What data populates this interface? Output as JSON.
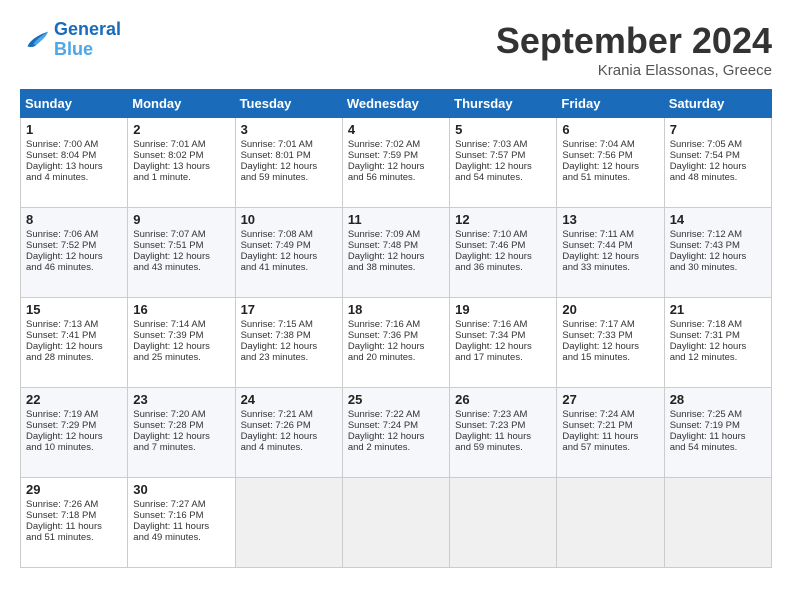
{
  "logo": {
    "line1": "General",
    "line2": "Blue"
  },
  "title": "September 2024",
  "location": "Krania Elassonas, Greece",
  "headers": [
    "Sunday",
    "Monday",
    "Tuesday",
    "Wednesday",
    "Thursday",
    "Friday",
    "Saturday"
  ],
  "weeks": [
    [
      {
        "day": "1",
        "lines": [
          "Sunrise: 7:00 AM",
          "Sunset: 8:04 PM",
          "Daylight: 13 hours",
          "and 4 minutes."
        ]
      },
      {
        "day": "2",
        "lines": [
          "Sunrise: 7:01 AM",
          "Sunset: 8:02 PM",
          "Daylight: 13 hours",
          "and 1 minute."
        ]
      },
      {
        "day": "3",
        "lines": [
          "Sunrise: 7:01 AM",
          "Sunset: 8:01 PM",
          "Daylight: 12 hours",
          "and 59 minutes."
        ]
      },
      {
        "day": "4",
        "lines": [
          "Sunrise: 7:02 AM",
          "Sunset: 7:59 PM",
          "Daylight: 12 hours",
          "and 56 minutes."
        ]
      },
      {
        "day": "5",
        "lines": [
          "Sunrise: 7:03 AM",
          "Sunset: 7:57 PM",
          "Daylight: 12 hours",
          "and 54 minutes."
        ]
      },
      {
        "day": "6",
        "lines": [
          "Sunrise: 7:04 AM",
          "Sunset: 7:56 PM",
          "Daylight: 12 hours",
          "and 51 minutes."
        ]
      },
      {
        "day": "7",
        "lines": [
          "Sunrise: 7:05 AM",
          "Sunset: 7:54 PM",
          "Daylight: 12 hours",
          "and 48 minutes."
        ]
      }
    ],
    [
      {
        "day": "8",
        "lines": [
          "Sunrise: 7:06 AM",
          "Sunset: 7:52 PM",
          "Daylight: 12 hours",
          "and 46 minutes."
        ]
      },
      {
        "day": "9",
        "lines": [
          "Sunrise: 7:07 AM",
          "Sunset: 7:51 PM",
          "Daylight: 12 hours",
          "and 43 minutes."
        ]
      },
      {
        "day": "10",
        "lines": [
          "Sunrise: 7:08 AM",
          "Sunset: 7:49 PM",
          "Daylight: 12 hours",
          "and 41 minutes."
        ]
      },
      {
        "day": "11",
        "lines": [
          "Sunrise: 7:09 AM",
          "Sunset: 7:48 PM",
          "Daylight: 12 hours",
          "and 38 minutes."
        ]
      },
      {
        "day": "12",
        "lines": [
          "Sunrise: 7:10 AM",
          "Sunset: 7:46 PM",
          "Daylight: 12 hours",
          "and 36 minutes."
        ]
      },
      {
        "day": "13",
        "lines": [
          "Sunrise: 7:11 AM",
          "Sunset: 7:44 PM",
          "Daylight: 12 hours",
          "and 33 minutes."
        ]
      },
      {
        "day": "14",
        "lines": [
          "Sunrise: 7:12 AM",
          "Sunset: 7:43 PM",
          "Daylight: 12 hours",
          "and 30 minutes."
        ]
      }
    ],
    [
      {
        "day": "15",
        "lines": [
          "Sunrise: 7:13 AM",
          "Sunset: 7:41 PM",
          "Daylight: 12 hours",
          "and 28 minutes."
        ]
      },
      {
        "day": "16",
        "lines": [
          "Sunrise: 7:14 AM",
          "Sunset: 7:39 PM",
          "Daylight: 12 hours",
          "and 25 minutes."
        ]
      },
      {
        "day": "17",
        "lines": [
          "Sunrise: 7:15 AM",
          "Sunset: 7:38 PM",
          "Daylight: 12 hours",
          "and 23 minutes."
        ]
      },
      {
        "day": "18",
        "lines": [
          "Sunrise: 7:16 AM",
          "Sunset: 7:36 PM",
          "Daylight: 12 hours",
          "and 20 minutes."
        ]
      },
      {
        "day": "19",
        "lines": [
          "Sunrise: 7:16 AM",
          "Sunset: 7:34 PM",
          "Daylight: 12 hours",
          "and 17 minutes."
        ]
      },
      {
        "day": "20",
        "lines": [
          "Sunrise: 7:17 AM",
          "Sunset: 7:33 PM",
          "Daylight: 12 hours",
          "and 15 minutes."
        ]
      },
      {
        "day": "21",
        "lines": [
          "Sunrise: 7:18 AM",
          "Sunset: 7:31 PM",
          "Daylight: 12 hours",
          "and 12 minutes."
        ]
      }
    ],
    [
      {
        "day": "22",
        "lines": [
          "Sunrise: 7:19 AM",
          "Sunset: 7:29 PM",
          "Daylight: 12 hours",
          "and 10 minutes."
        ]
      },
      {
        "day": "23",
        "lines": [
          "Sunrise: 7:20 AM",
          "Sunset: 7:28 PM",
          "Daylight: 12 hours",
          "and 7 minutes."
        ]
      },
      {
        "day": "24",
        "lines": [
          "Sunrise: 7:21 AM",
          "Sunset: 7:26 PM",
          "Daylight: 12 hours",
          "and 4 minutes."
        ]
      },
      {
        "day": "25",
        "lines": [
          "Sunrise: 7:22 AM",
          "Sunset: 7:24 PM",
          "Daylight: 12 hours",
          "and 2 minutes."
        ]
      },
      {
        "day": "26",
        "lines": [
          "Sunrise: 7:23 AM",
          "Sunset: 7:23 PM",
          "Daylight: 11 hours",
          "and 59 minutes."
        ]
      },
      {
        "day": "27",
        "lines": [
          "Sunrise: 7:24 AM",
          "Sunset: 7:21 PM",
          "Daylight: 11 hours",
          "and 57 minutes."
        ]
      },
      {
        "day": "28",
        "lines": [
          "Sunrise: 7:25 AM",
          "Sunset: 7:19 PM",
          "Daylight: 11 hours",
          "and 54 minutes."
        ]
      }
    ],
    [
      {
        "day": "29",
        "lines": [
          "Sunrise: 7:26 AM",
          "Sunset: 7:18 PM",
          "Daylight: 11 hours",
          "and 51 minutes."
        ]
      },
      {
        "day": "30",
        "lines": [
          "Sunrise: 7:27 AM",
          "Sunset: 7:16 PM",
          "Daylight: 11 hours",
          "and 49 minutes."
        ]
      },
      {
        "day": "",
        "lines": []
      },
      {
        "day": "",
        "lines": []
      },
      {
        "day": "",
        "lines": []
      },
      {
        "day": "",
        "lines": []
      },
      {
        "day": "",
        "lines": []
      }
    ]
  ]
}
